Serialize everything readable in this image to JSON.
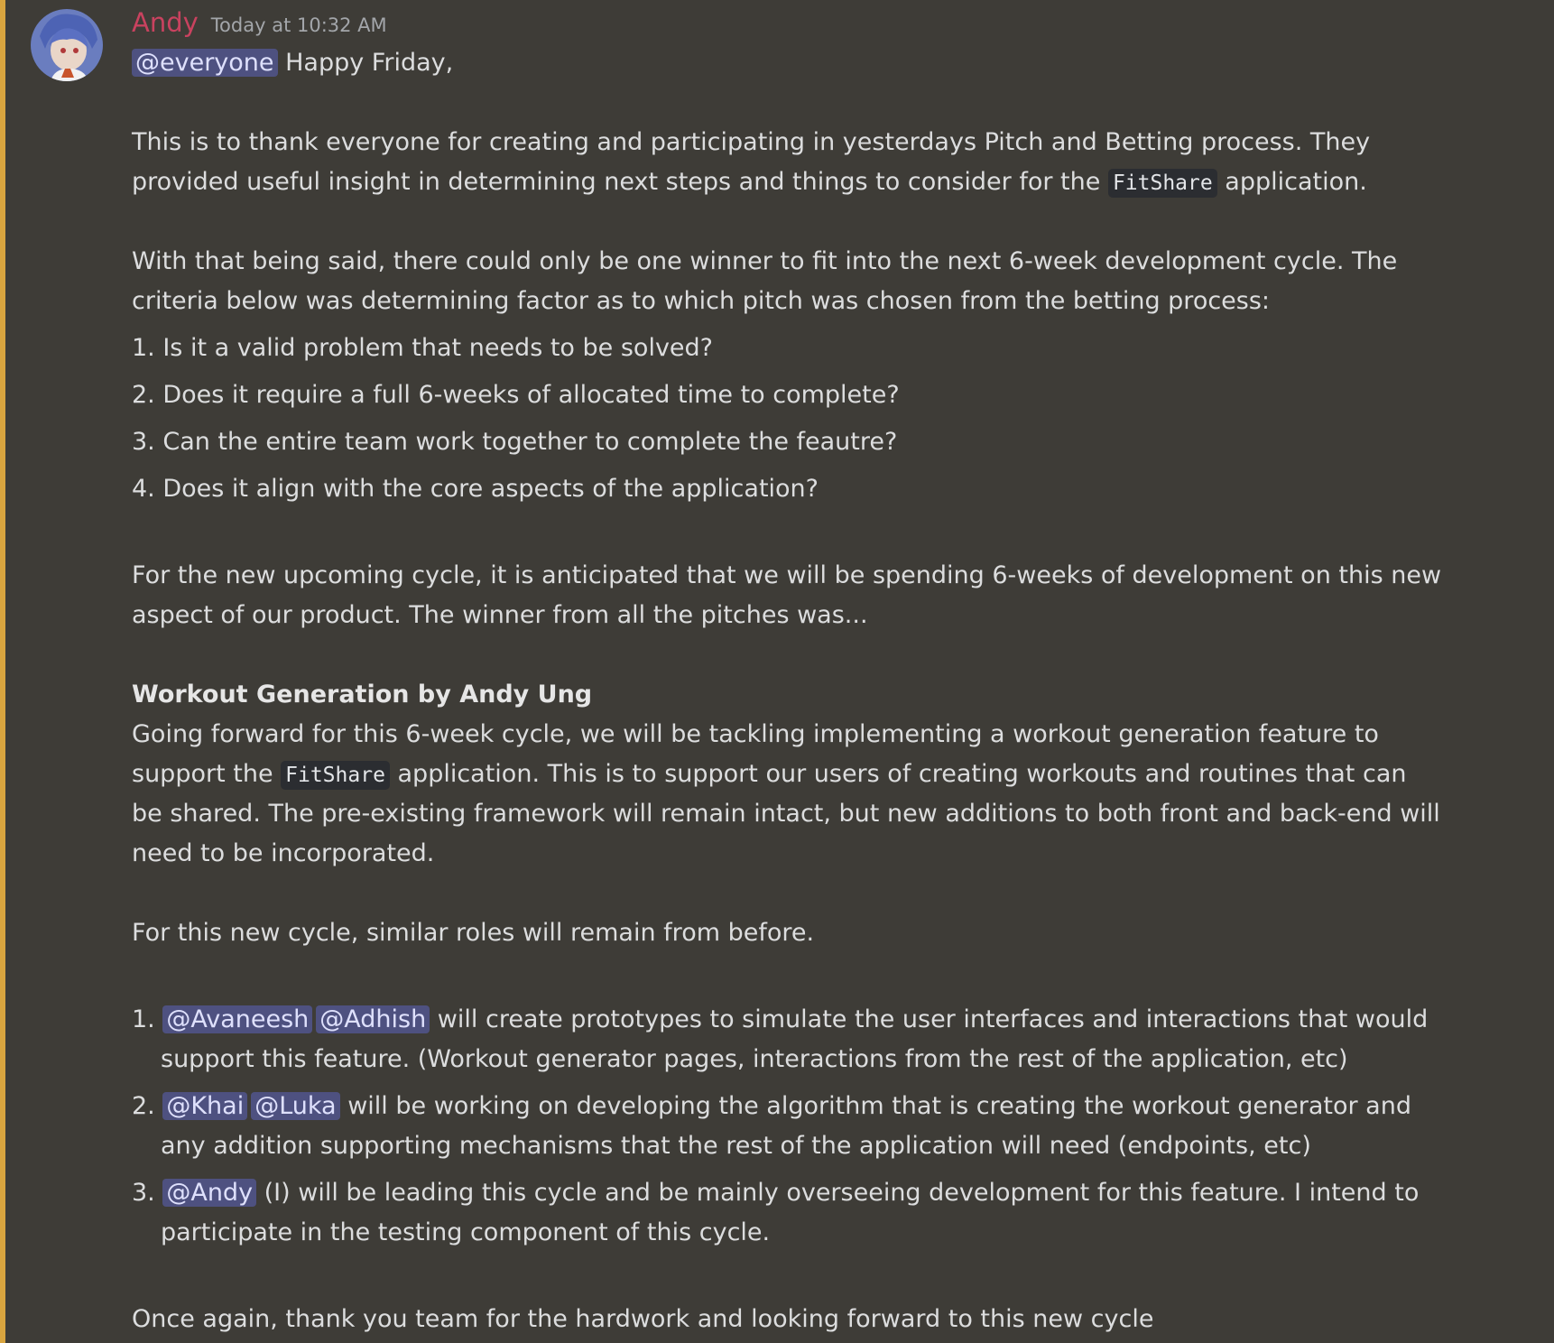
{
  "message": {
    "author": "Andy",
    "timestamp": "Today at 10:32 AM",
    "greeting_mention": "@everyone",
    "greeting_text": " Happy Friday,",
    "p1_line1": "This is to thank everyone for creating and participating in yesterdays Pitch and Betting process. They",
    "p1_line2_a": "provided useful insight in determining next steps and things to consider for the ",
    "p1_code": "FitShare",
    "p1_line2_b": " application.",
    "p2_line1": "With that being said, there could only be one winner to fit into the next 6-week development cycle. The",
    "p2_line2": "criteria below was determining factor as to which pitch was chosen from the betting process:",
    "criteria": [
      "1. Is it a valid problem that needs to be solved?",
      "2. Does it require a full 6-weeks of allocated time to complete?",
      "3. Can the entire team work together to complete the feautre?",
      "4. Does it align with the core aspects of the application?"
    ],
    "p3_line1": "For the new upcoming cycle, it is anticipated that we will be spending 6-weeks of development on this new",
    "p3_line2": "aspect of our product.  The winner from all the pitches was...",
    "winner_title": "Workout Generation by Andy Ung",
    "p4_line1": "Going forward for this 6-week cycle, we will be tackling implementing a workout generation feature to",
    "p4_line2_a": "support the ",
    "p4_code": "FitShare",
    "p4_line2_b": " application. This is to support our users of creating workouts and routines that can",
    "p4_line3": "be shared. The pre-existing framework will remain intact, but new additions to both front and back-end will",
    "p4_line4": "need to be incorporated.",
    "p5": "For this new cycle, similar roles will remain from before.",
    "roles": [
      {
        "num": "1. ",
        "mentions": [
          "@Avaneesh",
          "@Adhish"
        ],
        "line1": "  will create prototypes to simulate the user interfaces and interactions that would",
        "line2": "support this feature.  (Workout generator pages, interactions from the rest of the application, etc)"
      },
      {
        "num": "2. ",
        "mentions": [
          "@Khai",
          "@Luka"
        ],
        "line1": "  will be working on developing the algorithm that is creating the workout generator and",
        "line2": "any addition supporting mechanisms that the rest of the application will need (endpoints, etc)"
      },
      {
        "num": "3. ",
        "mentions": [
          "@Andy"
        ],
        "line1": " (I) will be leading this cycle and be mainly overseeing development for this feature. I intend to",
        "line2": "participate in the testing component of this cycle."
      }
    ],
    "closing": "Once again, thank you team for the hardwork and looking forward to this new cycle"
  },
  "colors": {
    "background": "#3e3c37",
    "highlight_bar": "#d9a53f",
    "author": "#c9425f",
    "mention_bg": "#4e5180",
    "code_bg": "#2b2d31"
  }
}
